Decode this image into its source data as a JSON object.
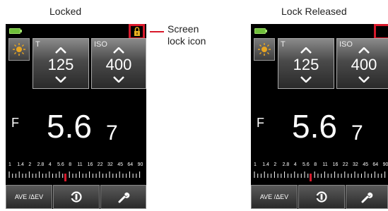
{
  "captions": {
    "left": "Locked",
    "right": "Lock Released"
  },
  "annotation": {
    "line1": "Screen",
    "line2": "lock icon"
  },
  "meter": {
    "t_label": "T",
    "t_value": "125",
    "iso_label": "ISO",
    "iso_value": "400",
    "f_label": "F",
    "f_value": "5.6",
    "f_tenths": "7",
    "scale_labels": [
      "1",
      "1.4",
      "2",
      "2.8",
      "4",
      "5.6",
      "8",
      "11",
      "16",
      "22",
      "32",
      "45",
      "64",
      "90"
    ],
    "ave_label": "AVE /ΔEV"
  },
  "colors": {
    "highlight": "#d8192b",
    "lock_icon": "#e8b020",
    "battery": "#6fbf3a"
  },
  "icons": {
    "lock": "lock-icon",
    "sun": "sun-icon",
    "sync": "sync-icon",
    "wrench": "wrench-icon"
  }
}
